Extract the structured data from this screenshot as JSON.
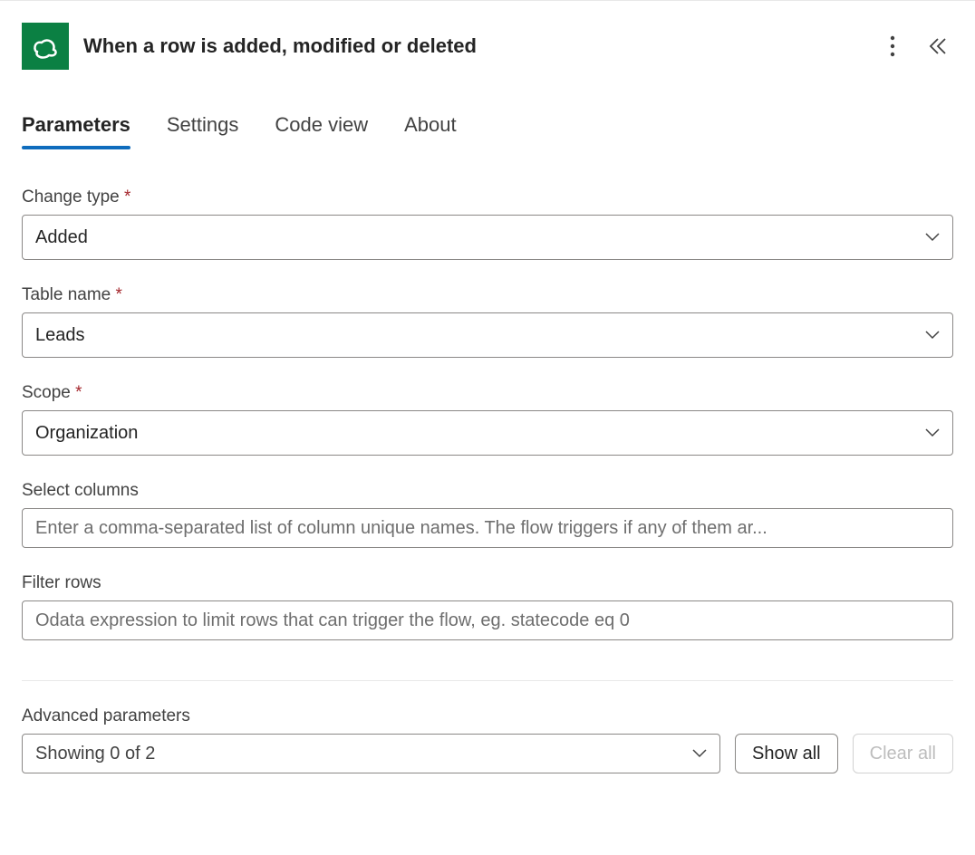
{
  "header": {
    "title": "When a row is added, modified or deleted"
  },
  "tabs": {
    "parameters": "Parameters",
    "settings": "Settings",
    "codeview": "Code view",
    "about": "About"
  },
  "fields": {
    "change_type": {
      "label": "Change type",
      "value": "Added"
    },
    "table_name": {
      "label": "Table name",
      "value": "Leads"
    },
    "scope": {
      "label": "Scope",
      "value": "Organization"
    },
    "select_columns": {
      "label": "Select columns",
      "placeholder": "Enter a comma-separated list of column unique names. The flow triggers if any of them ar..."
    },
    "filter_rows": {
      "label": "Filter rows",
      "placeholder": "Odata expression to limit rows that can trigger the flow, eg. statecode eq 0"
    }
  },
  "advanced": {
    "label": "Advanced parameters",
    "showing": "Showing 0 of 2",
    "show_all": "Show all",
    "clear_all": "Clear all"
  }
}
